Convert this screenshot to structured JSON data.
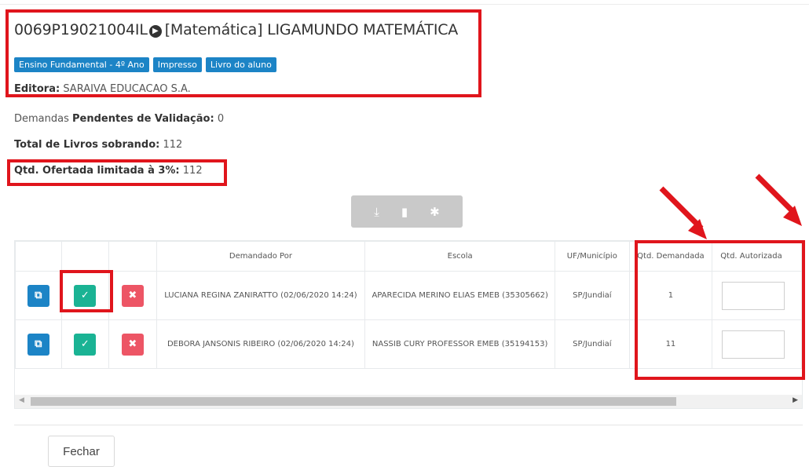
{
  "book": {
    "code": "0069P19021004IL",
    "arrow_icon": "arrow-right-circle-icon",
    "title": "[Matemática] LIGAMUNDO MATEMÁTICA",
    "badges": [
      "Ensino Fundamental - 4º Ano",
      "Impresso",
      "Livro do aluno"
    ],
    "editora_label": "Editora:",
    "editora_value": "SARAIVA EDUCACAO S.A."
  },
  "summary": {
    "pendentes_prefix": "Demandas",
    "pendentes_label": "Pendentes de Validação:",
    "pendentes_value": "0",
    "total_label": "Total de Livros sobrando:",
    "total_value": "112",
    "ofertada_label": "Qtd. Ofertada limitada à 3%:",
    "ofertada_value": "112"
  },
  "toolbar": {
    "icons": [
      "download-icon",
      "file-icon",
      "gear-icon"
    ],
    "glyphs": [
      "⤓",
      "▮",
      "✱"
    ]
  },
  "table": {
    "headers": {
      "demandado_por": "Demandado Por",
      "escola": "Escola",
      "uf_municipio": "UF/Município",
      "qtd_demandada": "Qtd. Demandada",
      "qtd_autorizada": "Qtd. Autorizada"
    },
    "action_icons": {
      "pdf": "pdf-icon",
      "approve": "check-icon",
      "reject": "close-icon",
      "pdf_glyph": "⧉",
      "approve_glyph": "✓",
      "reject_glyph": "✖"
    },
    "rows": [
      {
        "demandado_por": "LUCIANA REGINA ZANIRATTO (02/06/2020 14:24)",
        "escola": "APARECIDA MERINO ELIAS EMEB (35305662)",
        "uf_municipio": "SP/Jundiaí",
        "qtd_demandada": "1",
        "qtd_autorizada": ""
      },
      {
        "demandado_por": "DEBORA JANSONIS RIBEIRO (02/06/2020 14:24)",
        "escola": "NASSIB CURY PROFESSOR EMEB (35194153)",
        "uf_municipio": "SP/Jundiaí",
        "qtd_demandada": "11",
        "qtd_autorizada": ""
      }
    ]
  },
  "footer": {
    "close_label": "Fechar"
  },
  "colors": {
    "primary": "#1c84c6",
    "success": "#1ab394",
    "danger": "#ed5565",
    "annotation": "#e0151c"
  }
}
